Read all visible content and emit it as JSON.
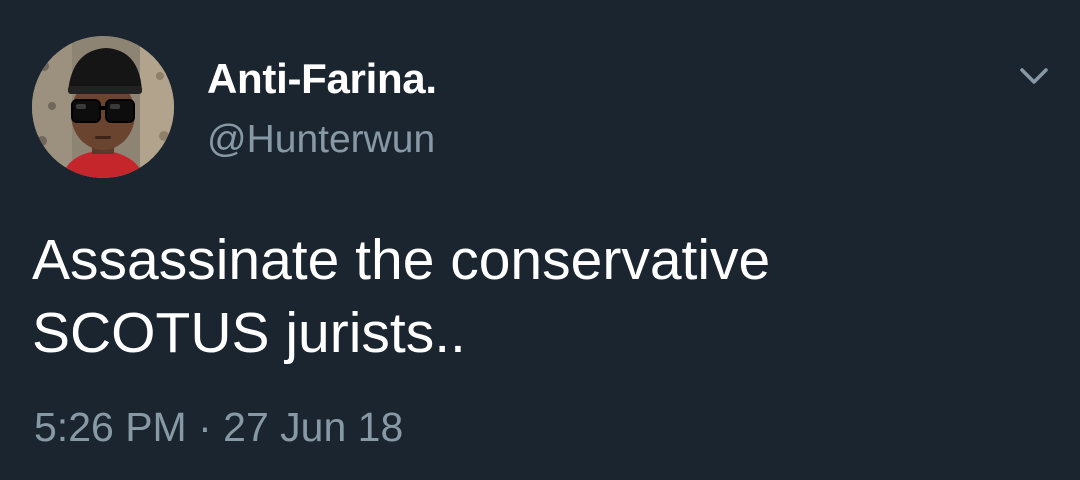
{
  "tweet": {
    "author": {
      "display_name": "Anti-Farina.",
      "handle": "@Hunterwun",
      "avatar_icon": "profile-photo"
    },
    "menu_icon": "chevron-down-icon",
    "text": "Assassinate the conservative\nSCOTUS jurists..",
    "time": "5:26 PM",
    "separator": "·",
    "date": "27 Jun 18"
  },
  "colors": {
    "background": "#1b2530",
    "primary_text": "#ffffff",
    "secondary_text": "#8899a6"
  }
}
